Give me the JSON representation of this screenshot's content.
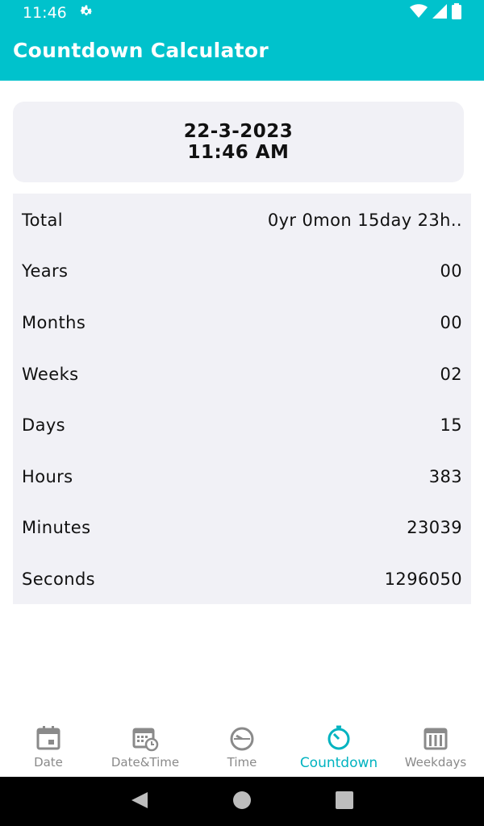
{
  "status_bar": {
    "time": "11:46",
    "icons": [
      "gear-icon",
      "wifi-icon",
      "signal-icon",
      "battery-icon"
    ]
  },
  "app_bar": {
    "title": "Countdown Calculator",
    "color": "#00c2cc"
  },
  "date_card": {
    "date": "22-3-2023",
    "time": "11:46 AM"
  },
  "results": [
    {
      "label": "Total",
      "value": "0yr 0mon 15day 23h.."
    },
    {
      "label": "Years",
      "value": "00"
    },
    {
      "label": "Months",
      "value": "00"
    },
    {
      "label": "Weeks",
      "value": "02"
    },
    {
      "label": "Days",
      "value": "15"
    },
    {
      "label": "Hours",
      "value": "383"
    },
    {
      "label": "Minutes",
      "value": "23039"
    },
    {
      "label": "Seconds",
      "value": "1296050"
    }
  ],
  "bottom_nav": [
    {
      "label": "Date",
      "icon": "calendar-icon",
      "active": false
    },
    {
      "label": "Date&Time",
      "icon": "calendar-clock-icon",
      "active": false
    },
    {
      "label": "Time",
      "icon": "clock-icon",
      "active": false
    },
    {
      "label": "Countdown",
      "icon": "timer-icon",
      "active": true
    },
    {
      "label": "Weekdays",
      "icon": "weekdays-icon",
      "active": false
    }
  ],
  "accent_color": "#00b3c0"
}
